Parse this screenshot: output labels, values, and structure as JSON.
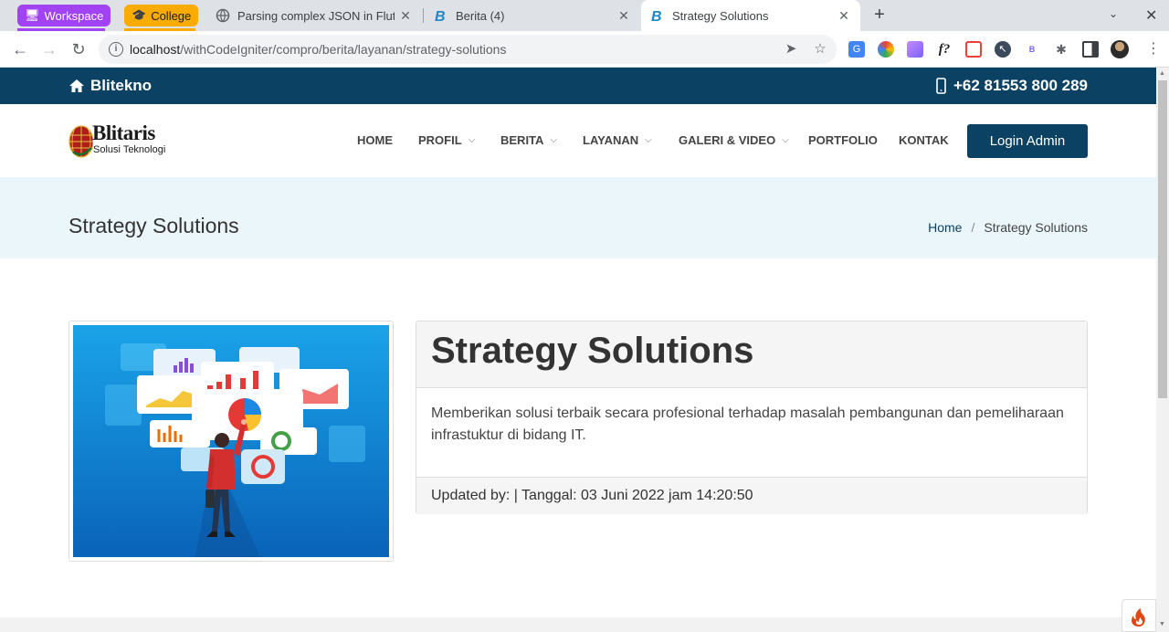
{
  "browser": {
    "tab_groups": [
      {
        "label": "Workspace",
        "color": "#a142f4"
      },
      {
        "label": "College",
        "color": "#f9ab00"
      }
    ],
    "tabs": [
      {
        "title": "Parsing complex JSON in Flutt",
        "active": false
      },
      {
        "title": "Berita (4)",
        "active": false
      },
      {
        "title": "Strategy Solutions",
        "active": true
      }
    ],
    "url_host": "localhost",
    "url_path": "/withCodeIgniter/compro/berita/layanan/strategy-solutions"
  },
  "topbar": {
    "brand": "Blitekno",
    "phone": "+62 81553 800 289"
  },
  "logo": {
    "name": "Blitaris",
    "tagline": "Solusi Teknologi"
  },
  "nav": {
    "items": [
      {
        "label": "HOME",
        "dropdown": false
      },
      {
        "label": "PROFIL",
        "dropdown": true
      },
      {
        "label": "BERITA",
        "dropdown": true
      },
      {
        "label": "LAYANAN",
        "dropdown": true
      },
      {
        "label": "GALERI & VIDEO",
        "dropdown": true
      },
      {
        "label": "PORTFOLIO",
        "dropdown": false
      },
      {
        "label": "KONTAK",
        "dropdown": false
      }
    ],
    "login_label": "Login Admin"
  },
  "page_header": {
    "title": "Strategy Solutions",
    "breadcrumb_home": "Home",
    "breadcrumb_sep": "/",
    "breadcrumb_current": "Strategy Solutions"
  },
  "article": {
    "heading": "Strategy Solutions",
    "body": "Memberikan solusi terbaik secara profesional terhadap masalah pembangunan dan pemeliharaan infrastuktur di bidang IT.",
    "footer": "Updated by: | Tanggal: 03 Juni 2022 jam 14:20:50"
  },
  "colors": {
    "primary": "#0b4263",
    "band": "#eaf6f9",
    "panel_bg": "#f5f5f5"
  }
}
